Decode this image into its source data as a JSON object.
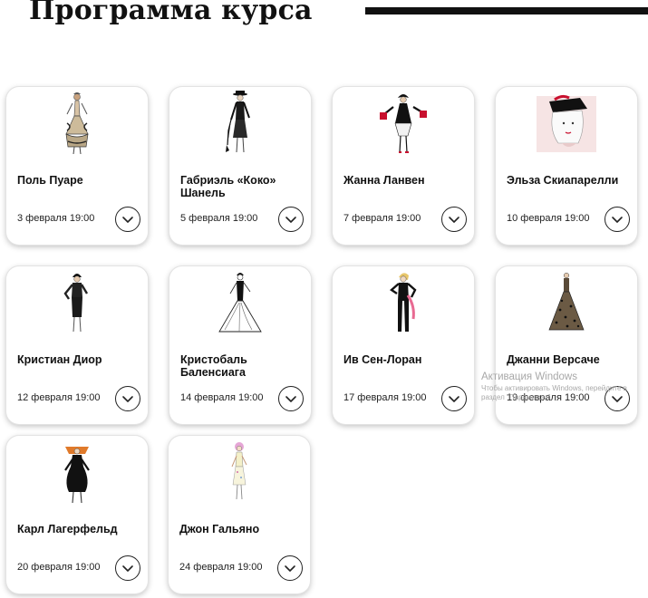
{
  "page": {
    "title": "Программа курса"
  },
  "courses": [
    {
      "name": "Поль Пуаре",
      "date": "3 февраля 19:00",
      "icon": "poiret-dress-illustration"
    },
    {
      "name": "Габриэль «Коко» Шанель",
      "date": "5 февраля 19:00",
      "icon": "chanel-dress-illustration"
    },
    {
      "name": "Жанна Ланвен",
      "date": "7 февраля 19:00",
      "icon": "lanvin-dress-illustration"
    },
    {
      "name": "Эльза Скиапарелли",
      "date": "10 февраля 19:00",
      "icon": "schiaparelli-hat-illustration"
    },
    {
      "name": "Кристиан Диор",
      "date": "12 февраля 19:00",
      "icon": "dior-dress-illustration"
    },
    {
      "name": "Кристобаль Баленсиага",
      "date": "14 февраля 19:00",
      "icon": "balenciaga-gown-illustration"
    },
    {
      "name": "Ив Сен-Лоран",
      "date": "17 февраля 19:00",
      "icon": "saint-laurent-suit-illustration"
    },
    {
      "name": "Джанни Версаче",
      "date": "19 февраля 19:00",
      "icon": "versace-gown-illustration"
    },
    {
      "name": "Карл Лагерфельд",
      "date": "20 февраля 19:00",
      "icon": "lagerfeld-dress-illustration"
    },
    {
      "name": "Джон Гальяно",
      "date": "24 февраля 19:00",
      "icon": "galliano-dress-illustration"
    }
  ],
  "watermark": {
    "title": "Активация Windows",
    "text": "Чтобы активировать Windows, перейдите в раздел \"Параметры\"."
  },
  "colors": {
    "accent": "#111111",
    "card_border": "#e3e3e3",
    "background": "#ffffff"
  }
}
